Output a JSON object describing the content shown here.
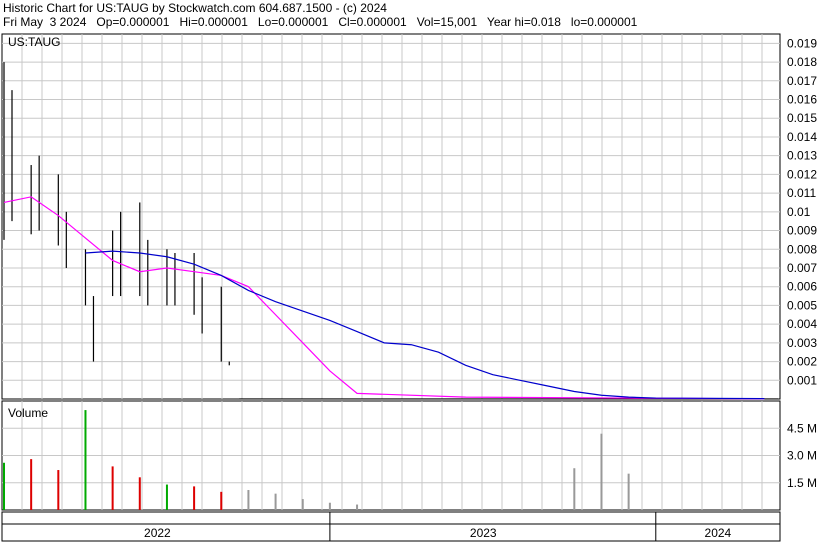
{
  "header": {
    "title_line": "Historic Chart for US:TAUG by Stockwatch.com 604.687.1500 - (c) 2024",
    "date": "Fri May  3 2024",
    "open": "Op=0.000001",
    "high": "Hi=0.000001",
    "low": "Lo=0.000001",
    "close": "Cl=0.000001",
    "volume": "Vol=15,001",
    "year_high": "Year hi=0.018",
    "year_low": "lo=0.000001"
  },
  "price_panel": {
    "symbol_label": "US:TAUG"
  },
  "volume_panel": {
    "label": "Volume"
  },
  "colors": {
    "price_bars": "#000000",
    "ma_short": "#ff00ff",
    "ma_long": "#0000cc",
    "volume_up": "#00aa00",
    "volume_down": "#dd0000",
    "volume_flat": "#999999",
    "grid": "#c8c8c8",
    "frame": "#000000"
  },
  "chart_data": [
    {
      "type": "line",
      "panel": "price",
      "ylim": [
        0,
        0.0195
      ],
      "y_ticks": [
        "0.019",
        "0.018",
        "0.017",
        "0.016",
        "0.015",
        "0.014",
        "0.013",
        "0.012",
        "0.011",
        "0.01",
        "0.009",
        "0.008",
        "0.007",
        "0.006",
        "0.005",
        "0.004",
        "0.003",
        "0.002",
        "0.001"
      ],
      "y_tick_values": [
        0.019,
        0.018,
        0.017,
        0.016,
        0.015,
        0.014,
        0.013,
        0.012,
        0.011,
        0.01,
        0.009,
        0.008,
        0.007,
        0.006,
        0.005,
        0.004,
        0.003,
        0.002,
        0.001
      ],
      "x_labels": [
        "2022",
        "2023",
        "2024"
      ],
      "grid": true,
      "series": [
        {
          "kind": "ma-short",
          "x": [
            "2022-01",
            "2022-02",
            "2022-03",
            "2022-04",
            "2022-05",
            "2022-06",
            "2022-07",
            "2022-08",
            "2022-09",
            "2022-10",
            "2022-11",
            "2022-12",
            "2023-01",
            "2023-02",
            "2023-06",
            "2023-12",
            "2024-05"
          ],
          "values": [
            0.0105,
            0.0108,
            0.0098,
            0.0086,
            0.0074,
            0.0068,
            0.007,
            0.0068,
            0.0066,
            0.006,
            0.0045,
            0.003,
            0.0015,
            0.0003,
            0.0001,
            5e-05,
            1e-05
          ]
        },
        {
          "kind": "ma-long",
          "x": [
            "2022-04",
            "2022-05",
            "2022-06",
            "2022-07",
            "2022-08",
            "2022-09",
            "2022-10",
            "2022-11",
            "2022-12",
            "2023-01",
            "2023-02",
            "2023-03",
            "2023-04",
            "2023-05",
            "2023-06",
            "2023-07",
            "2023-08",
            "2023-09",
            "2023-10",
            "2023-11",
            "2023-12",
            "2024-01",
            "2024-05"
          ],
          "values": [
            0.0078,
            0.0079,
            0.0078,
            0.0076,
            0.0072,
            0.0066,
            0.0058,
            0.0052,
            0.0047,
            0.0042,
            0.0036,
            0.003,
            0.0029,
            0.0025,
            0.0018,
            0.0013,
            0.001,
            0.0007,
            0.0004,
            0.0002,
            0.0001,
            5e-05,
            2e-05
          ]
        }
      ],
      "ohlc": [
        {
          "x": "2022-01",
          "high": 0.018,
          "low": 0.0085
        },
        {
          "x": "2022-01b",
          "high": 0.0165,
          "low": 0.0095
        },
        {
          "x": "2022-02",
          "high": 0.0125,
          "low": 0.0088
        },
        {
          "x": "2022-02b",
          "high": 0.013,
          "low": 0.009
        },
        {
          "x": "2022-03",
          "high": 0.012,
          "low": 0.0082
        },
        {
          "x": "2022-03b",
          "high": 0.01,
          "low": 0.007
        },
        {
          "x": "2022-04",
          "high": 0.008,
          "low": 0.005
        },
        {
          "x": "2022-04b",
          "high": 0.0055,
          "low": 0.002
        },
        {
          "x": "2022-05",
          "high": 0.009,
          "low": 0.0055
        },
        {
          "x": "2022-05b",
          "high": 0.01,
          "low": 0.0055
        },
        {
          "x": "2022-06",
          "high": 0.0105,
          "low": 0.0055
        },
        {
          "x": "2022-06b",
          "high": 0.0085,
          "low": 0.005
        },
        {
          "x": "2022-07",
          "high": 0.008,
          "low": 0.005
        },
        {
          "x": "2022-07b",
          "high": 0.0078,
          "low": 0.005
        },
        {
          "x": "2022-08",
          "high": 0.0078,
          "low": 0.0045
        },
        {
          "x": "2022-08b",
          "high": 0.0065,
          "low": 0.0035
        },
        {
          "x": "2022-09",
          "high": 0.006,
          "low": 0.002
        },
        {
          "x": "2022-09b",
          "high": 0.002,
          "low": 0.0018
        }
      ]
    },
    {
      "type": "bar",
      "panel": "volume",
      "ylim": [
        0,
        6000000
      ],
      "y_ticks": [
        "4.5 M",
        "3.0 M",
        "1.5 M"
      ],
      "y_tick_values": [
        4500000,
        3000000,
        1500000
      ],
      "series": [
        {
          "kind": "bars",
          "x": [
            "2022-01",
            "2022-02",
            "2022-03",
            "2022-04",
            "2022-05",
            "2022-06",
            "2022-07",
            "2022-08",
            "2022-09",
            "2022-10",
            "2022-11",
            "2022-12",
            "2023-01",
            "2023-02",
            "2023-10",
            "2023-11",
            "2023-12"
          ],
          "values": [
            2600000,
            2800000,
            2200000,
            5500000,
            2400000,
            1800000,
            1400000,
            1300000,
            1000000,
            1100000,
            900000,
            600000,
            400000,
            300000,
            2300000,
            4200000,
            2000000
          ],
          "colors": [
            "#00aa00",
            "#dd0000",
            "#dd0000",
            "#00aa00",
            "#dd0000",
            "#dd0000",
            "#00aa00",
            "#dd0000",
            "#dd0000",
            "#999999",
            "#999999",
            "#999999",
            "#999999",
            "#999999",
            "#999999",
            "#999999",
            "#999999"
          ]
        }
      ]
    }
  ]
}
